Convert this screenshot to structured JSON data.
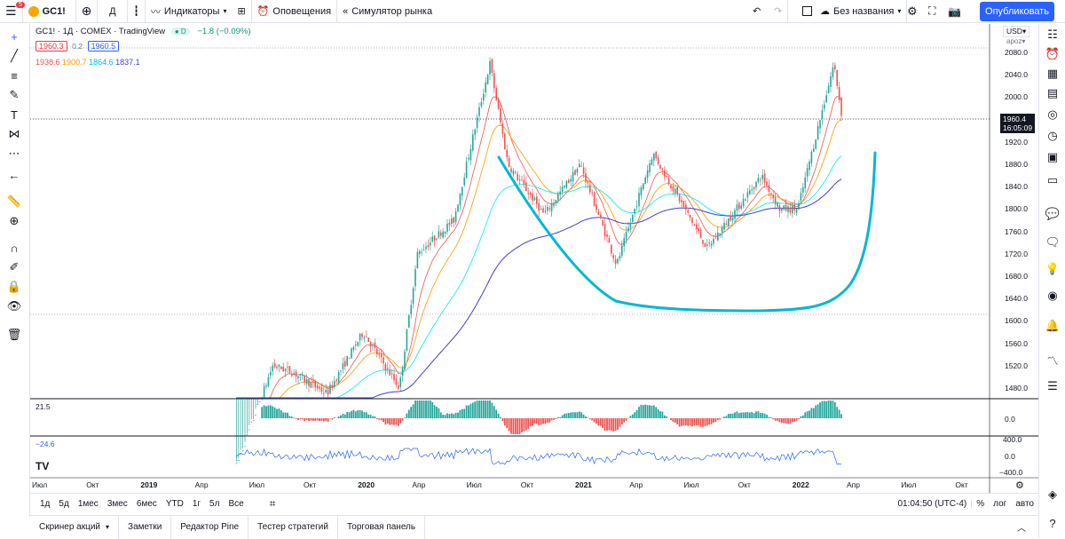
{
  "colors": {
    "accent": "#2962ff",
    "bull": "#26a69a",
    "bear": "#ef5350",
    "ema1": "#ef5350",
    "ema2": "#ff9800",
    "ema3": "#00e5ff",
    "ema4": "#3f3fd0",
    "drawing": "#00b8d4",
    "macd": "#2962ff"
  },
  "topbar": {
    "menu_badge": "5",
    "symbol": "GC1!",
    "interval": "Д",
    "indicators": "Индикаторы",
    "alerts": "Оповещения",
    "replay": "Симулятор рынка",
    "layout_name": "Без названия",
    "publish": "Опубликовать"
  },
  "legend": {
    "title": "GC1! · 1Д · COMEX · TradingView",
    "badge": "D",
    "change": "−1.8 (−0.09%)",
    "bid": "1960.3",
    "spread": "0.2",
    "ask": "1960.5",
    "ema_values": [
      "1938.6",
      "1900.7",
      "1864.6",
      "1837.1"
    ]
  },
  "price_axis": {
    "currency": "USD",
    "session": "apoz",
    "ticks": [
      "2080.0",
      "2040.0",
      "2000.0",
      "1960.0",
      "1920.0",
      "1880.0",
      "1840.0",
      "1800.0",
      "1760.0",
      "1720.0",
      "1680.0",
      "1640.0",
      "1600.0",
      "1560.0",
      "1520.0",
      "1480.0"
    ],
    "last_price": "1960.4",
    "countdown": "16:05:09"
  },
  "pane2": {
    "value": "21.5",
    "axis": "0.0"
  },
  "pane3": {
    "value": "−24.6",
    "axis_top": "400.0",
    "axis_mid": "0.0",
    "axis_bottom": "−400.0"
  },
  "time_axis": {
    "labels": [
      "Июл",
      "Окт",
      "2019",
      "Апр",
      "Июл",
      "Окт",
      "2020",
      "Апр",
      "Июл",
      "Окт",
      "2021",
      "Апр",
      "Июл",
      "Окт",
      "2022",
      "Апр",
      "Июл",
      "Окт"
    ]
  },
  "timeframes": [
    "1д",
    "5д",
    "1мес",
    "3мес",
    "6мес",
    "YTD",
    "1г",
    "5л",
    "Все"
  ],
  "status": {
    "clock": "01:04:50 (UTC-4)",
    "percent": "%",
    "log": "лог",
    "auto": "авто"
  },
  "bottom_tabs": [
    "Скринер акций",
    "Заметки",
    "Редактор Pine",
    "Тестер стратегий",
    "Торговая панель"
  ],
  "chart_data": {
    "type": "candlestick",
    "symbol": "GC1!",
    "interval": "1D",
    "x_range": [
      "2018-07",
      "2022-03"
    ],
    "y_range": [
      1460,
      2090
    ],
    "approx_close_path": [
      {
        "date": "2019-06",
        "close": 1340
      },
      {
        "date": "2019-08",
        "close": 1520
      },
      {
        "date": "2019-09",
        "close": 1510
      },
      {
        "date": "2019-11",
        "close": 1470
      },
      {
        "date": "2020-01",
        "close": 1580
      },
      {
        "date": "2020-03",
        "close": 1480
      },
      {
        "date": "2020-04",
        "close": 1720
      },
      {
        "date": "2020-06",
        "close": 1780
      },
      {
        "date": "2020-08",
        "close": 2060
      },
      {
        "date": "2020-09",
        "close": 1880
      },
      {
        "date": "2020-11",
        "close": 1790
      },
      {
        "date": "2021-01",
        "close": 1880
      },
      {
        "date": "2021-03",
        "close": 1700
      },
      {
        "date": "2021-05",
        "close": 1900
      },
      {
        "date": "2021-08",
        "close": 1730
      },
      {
        "date": "2021-11",
        "close": 1860
      },
      {
        "date": "2021-12",
        "close": 1800
      },
      {
        "date": "2022-01",
        "close": 1800
      },
      {
        "date": "2022-03",
        "close": 2060
      },
      {
        "date": "2022-03-15",
        "close": 1960
      }
    ],
    "moving_averages": [
      {
        "name": "EMA 1",
        "last": 1938.6
      },
      {
        "name": "EMA 2",
        "last": 1900.7
      },
      {
        "name": "EMA 3",
        "last": 1864.6
      },
      {
        "name": "EMA 4",
        "last": 1837.1
      }
    ]
  }
}
